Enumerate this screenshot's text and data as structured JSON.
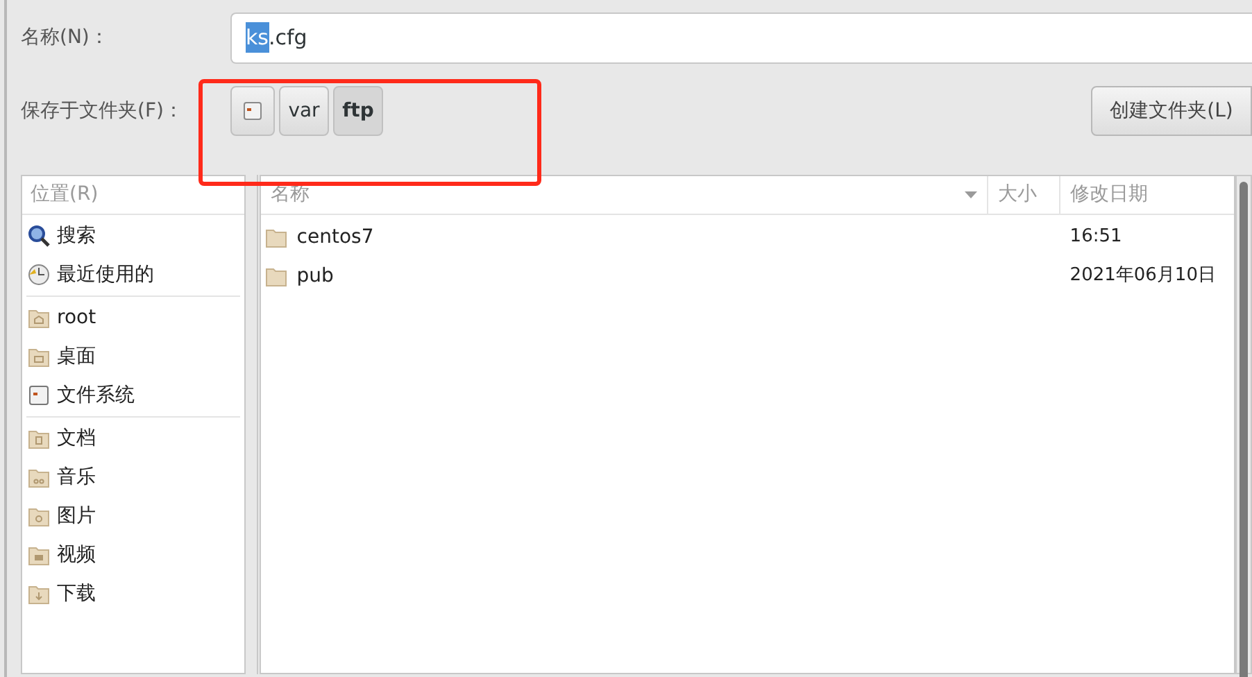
{
  "name_field": {
    "label": "名称(N)：",
    "value_parts": [
      {
        "text": "ks",
        "selected": true
      },
      {
        "text": ".cfg",
        "selected": false
      }
    ]
  },
  "folder_bar": {
    "label": "保存于文件夹(F)：",
    "path": [
      {
        "kind": "drive",
        "selected": false
      },
      {
        "kind": "text",
        "label": "var",
        "selected": false
      },
      {
        "kind": "text",
        "label": "ftp",
        "selected": true
      }
    ],
    "create_button": "创建文件夹(L)"
  },
  "annotation": {
    "kind": "rectangle",
    "color": "#ff2a1a"
  },
  "places": {
    "title": "位置(R)",
    "groups": [
      [
        {
          "kind": "search",
          "label": "搜索"
        },
        {
          "kind": "recent",
          "label": "最近使用的"
        }
      ],
      [
        {
          "kind": "home",
          "label": "root"
        },
        {
          "kind": "desktop",
          "label": "桌面"
        },
        {
          "kind": "drive",
          "label": "文件系统"
        }
      ],
      [
        {
          "kind": "documents",
          "label": "文档"
        },
        {
          "kind": "music",
          "label": "音乐"
        },
        {
          "kind": "pictures",
          "label": "图片"
        },
        {
          "kind": "videos",
          "label": "视频"
        },
        {
          "kind": "downloads",
          "label": "下载"
        }
      ]
    ]
  },
  "files": {
    "columns": [
      {
        "label": "名称",
        "sorted": true
      },
      {
        "label": "大小",
        "sorted": false
      },
      {
        "label": "修改日期",
        "sorted": false
      }
    ],
    "rows": [
      {
        "name": "centos7",
        "modified": "16:51"
      },
      {
        "name": "pub",
        "modified": "2021年06月10日"
      }
    ]
  }
}
